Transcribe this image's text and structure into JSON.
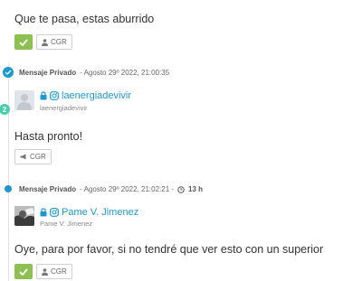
{
  "entries": [
    {
      "message": "Que te pasa, estas aburrido",
      "tag_label": "CGR"
    },
    {
      "header_label": "Mensaje Privado",
      "header_date": "- Agosto 29º 2022, 21:00:35",
      "badge_number": "2",
      "user_name": "laenergiadevivir",
      "user_sub": "laenergiadevivir",
      "message": "Hasta pronto!",
      "tag_label": "CGR"
    },
    {
      "header_label": "Mensaje Privado",
      "header_date": "- Agosto 29º 2022, 21:02:21 -",
      "header_elapsed": "13 h",
      "user_name": "Pame V. Jimenez",
      "user_sub": "Pame V. Jimenez",
      "message": "Oye, para por favor, si no tendré que ver esto con un superior",
      "tag_label": "CGR"
    }
  ],
  "colors": {
    "accent": "#1a98d5",
    "success": "#8cc152",
    "badge_teal": "#48cfad"
  },
  "icons": [
    "check-icon",
    "user-icon",
    "megaphone-icon",
    "lock-icon",
    "instagram-icon",
    "clock-icon",
    "verified-icon"
  ]
}
